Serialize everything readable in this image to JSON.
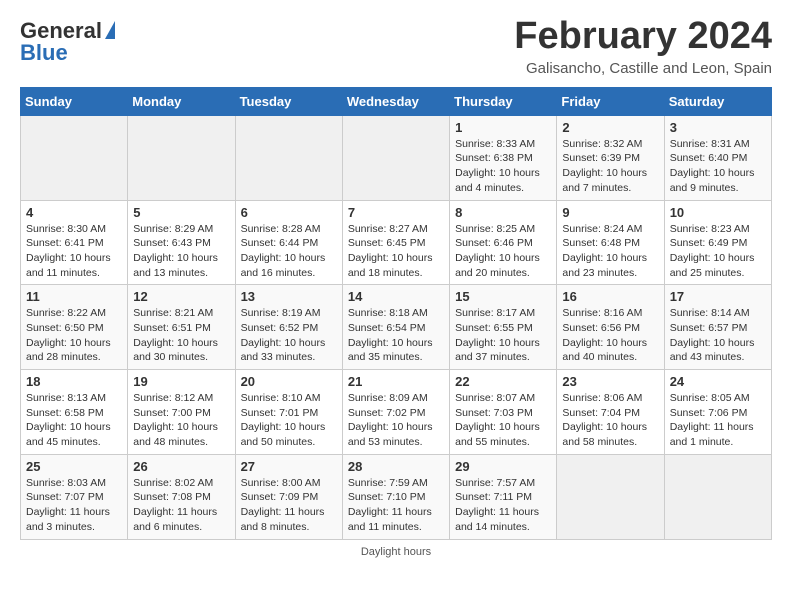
{
  "logo": {
    "general": "General",
    "blue": "Blue"
  },
  "title": "February 2024",
  "subtitle": "Galisancho, Castille and Leon, Spain",
  "days_of_week": [
    "Sunday",
    "Monday",
    "Tuesday",
    "Wednesday",
    "Thursday",
    "Friday",
    "Saturday"
  ],
  "weeks": [
    [
      {
        "num": "",
        "info": "",
        "empty": true
      },
      {
        "num": "",
        "info": "",
        "empty": true
      },
      {
        "num": "",
        "info": "",
        "empty": true
      },
      {
        "num": "",
        "info": "",
        "empty": true
      },
      {
        "num": "1",
        "info": "Sunrise: 8:33 AM\nSunset: 6:38 PM\nDaylight: 10 hours\nand 4 minutes.",
        "empty": false
      },
      {
        "num": "2",
        "info": "Sunrise: 8:32 AM\nSunset: 6:39 PM\nDaylight: 10 hours\nand 7 minutes.",
        "empty": false
      },
      {
        "num": "3",
        "info": "Sunrise: 8:31 AM\nSunset: 6:40 PM\nDaylight: 10 hours\nand 9 minutes.",
        "empty": false
      }
    ],
    [
      {
        "num": "4",
        "info": "Sunrise: 8:30 AM\nSunset: 6:41 PM\nDaylight: 10 hours\nand 11 minutes.",
        "empty": false
      },
      {
        "num": "5",
        "info": "Sunrise: 8:29 AM\nSunset: 6:43 PM\nDaylight: 10 hours\nand 13 minutes.",
        "empty": false
      },
      {
        "num": "6",
        "info": "Sunrise: 8:28 AM\nSunset: 6:44 PM\nDaylight: 10 hours\nand 16 minutes.",
        "empty": false
      },
      {
        "num": "7",
        "info": "Sunrise: 8:27 AM\nSunset: 6:45 PM\nDaylight: 10 hours\nand 18 minutes.",
        "empty": false
      },
      {
        "num": "8",
        "info": "Sunrise: 8:25 AM\nSunset: 6:46 PM\nDaylight: 10 hours\nand 20 minutes.",
        "empty": false
      },
      {
        "num": "9",
        "info": "Sunrise: 8:24 AM\nSunset: 6:48 PM\nDaylight: 10 hours\nand 23 minutes.",
        "empty": false
      },
      {
        "num": "10",
        "info": "Sunrise: 8:23 AM\nSunset: 6:49 PM\nDaylight: 10 hours\nand 25 minutes.",
        "empty": false
      }
    ],
    [
      {
        "num": "11",
        "info": "Sunrise: 8:22 AM\nSunset: 6:50 PM\nDaylight: 10 hours\nand 28 minutes.",
        "empty": false
      },
      {
        "num": "12",
        "info": "Sunrise: 8:21 AM\nSunset: 6:51 PM\nDaylight: 10 hours\nand 30 minutes.",
        "empty": false
      },
      {
        "num": "13",
        "info": "Sunrise: 8:19 AM\nSunset: 6:52 PM\nDaylight: 10 hours\nand 33 minutes.",
        "empty": false
      },
      {
        "num": "14",
        "info": "Sunrise: 8:18 AM\nSunset: 6:54 PM\nDaylight: 10 hours\nand 35 minutes.",
        "empty": false
      },
      {
        "num": "15",
        "info": "Sunrise: 8:17 AM\nSunset: 6:55 PM\nDaylight: 10 hours\nand 37 minutes.",
        "empty": false
      },
      {
        "num": "16",
        "info": "Sunrise: 8:16 AM\nSunset: 6:56 PM\nDaylight: 10 hours\nand 40 minutes.",
        "empty": false
      },
      {
        "num": "17",
        "info": "Sunrise: 8:14 AM\nSunset: 6:57 PM\nDaylight: 10 hours\nand 43 minutes.",
        "empty": false
      }
    ],
    [
      {
        "num": "18",
        "info": "Sunrise: 8:13 AM\nSunset: 6:58 PM\nDaylight: 10 hours\nand 45 minutes.",
        "empty": false
      },
      {
        "num": "19",
        "info": "Sunrise: 8:12 AM\nSunset: 7:00 PM\nDaylight: 10 hours\nand 48 minutes.",
        "empty": false
      },
      {
        "num": "20",
        "info": "Sunrise: 8:10 AM\nSunset: 7:01 PM\nDaylight: 10 hours\nand 50 minutes.",
        "empty": false
      },
      {
        "num": "21",
        "info": "Sunrise: 8:09 AM\nSunset: 7:02 PM\nDaylight: 10 hours\nand 53 minutes.",
        "empty": false
      },
      {
        "num": "22",
        "info": "Sunrise: 8:07 AM\nSunset: 7:03 PM\nDaylight: 10 hours\nand 55 minutes.",
        "empty": false
      },
      {
        "num": "23",
        "info": "Sunrise: 8:06 AM\nSunset: 7:04 PM\nDaylight: 10 hours\nand 58 minutes.",
        "empty": false
      },
      {
        "num": "24",
        "info": "Sunrise: 8:05 AM\nSunset: 7:06 PM\nDaylight: 11 hours\nand 1 minute.",
        "empty": false
      }
    ],
    [
      {
        "num": "25",
        "info": "Sunrise: 8:03 AM\nSunset: 7:07 PM\nDaylight: 11 hours\nand 3 minutes.",
        "empty": false
      },
      {
        "num": "26",
        "info": "Sunrise: 8:02 AM\nSunset: 7:08 PM\nDaylight: 11 hours\nand 6 minutes.",
        "empty": false
      },
      {
        "num": "27",
        "info": "Sunrise: 8:00 AM\nSunset: 7:09 PM\nDaylight: 11 hours\nand 8 minutes.",
        "empty": false
      },
      {
        "num": "28",
        "info": "Sunrise: 7:59 AM\nSunset: 7:10 PM\nDaylight: 11 hours\nand 11 minutes.",
        "empty": false
      },
      {
        "num": "29",
        "info": "Sunrise: 7:57 AM\nSunset: 7:11 PM\nDaylight: 11 hours\nand 14 minutes.",
        "empty": false
      },
      {
        "num": "",
        "info": "",
        "empty": true
      },
      {
        "num": "",
        "info": "",
        "empty": true
      }
    ]
  ],
  "footer": "Daylight hours"
}
